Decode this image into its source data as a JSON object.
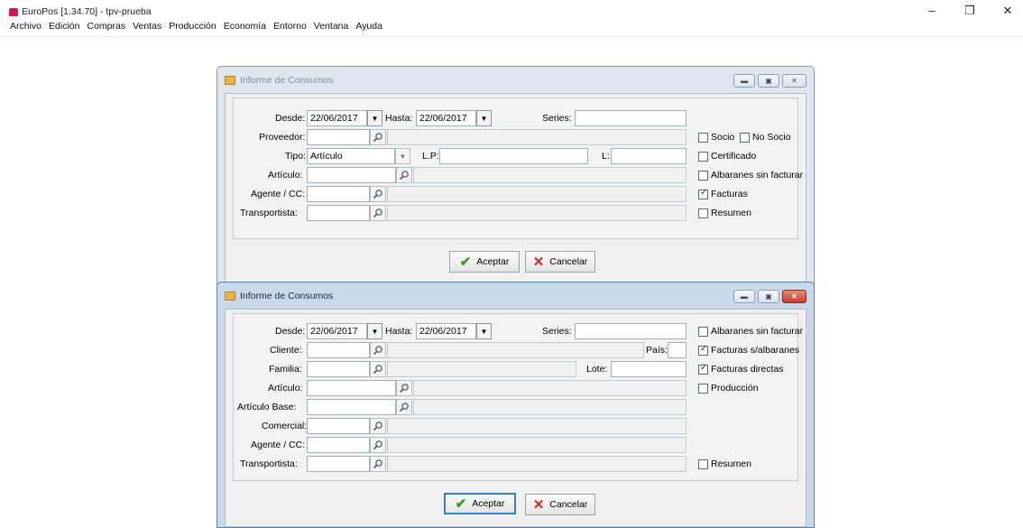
{
  "app": {
    "title": "EuroPos [1.34.70] - tpv-prueba"
  },
  "menu": [
    "Archivo",
    "Edición",
    "Compras",
    "Ventas",
    "Producción",
    "Economía",
    "Entorno",
    "Ventana",
    "Ayuda"
  ],
  "dialog1": {
    "title": "Informe de Consumos",
    "desde_label": "Desde:",
    "desde_value": "22/06/2017",
    "hasta_label": "Hasta:",
    "hasta_value": "22/06/2017",
    "series_label": "Series:",
    "series_value": "",
    "proveedor_label": "Proveedor:",
    "tipo_label": "Tipo:",
    "tipo_value": "Artículo",
    "lp_label": "L.P:",
    "l_label": "L:",
    "articulo_label": "Artículo:",
    "agente_label": "Agente / CC:",
    "transportista_label": "Transportista:",
    "socio_label": "Socio",
    "nosocio_label": "No Socio",
    "certificado_label": "Certificado",
    "albaranes_label": "Albaranes sin facturar",
    "facturas_label": "Facturas",
    "resumen_label": "Resumen",
    "checks": {
      "socio": false,
      "nosocio": false,
      "certificado": false,
      "albaranes": false,
      "facturas": true,
      "resumen": false
    },
    "aceptar_label": "Aceptar",
    "cancelar_label": "Cancelar"
  },
  "dialog2": {
    "title": "Informe de Consumos",
    "desde_label": "Desde:",
    "desde_value": "22/06/2017",
    "hasta_label": "Hasta:",
    "hasta_value": "22/06/2017",
    "series_label": "Series:",
    "cliente_label": "Cliente:",
    "pais_label": "País:",
    "familia_label": "Familia:",
    "lote_label": "Lote:",
    "articulo_label": "Artículo:",
    "articulo_base_label": "Artículo Base:",
    "comercial_label": "Comercial:",
    "agente_label": "Agente / CC:",
    "transportista_label": "Transportista:",
    "albaranes_label": "Albaranes sin facturar",
    "facturas_alb_label": "Facturas s/albaranes",
    "facturas_dir_label": "Facturas directas",
    "produccion_label": "Producción",
    "resumen_label": "Resumen",
    "checks": {
      "albaranes": false,
      "facturas_alb": true,
      "facturas_dir": true,
      "produccion": false,
      "resumen": false
    },
    "aceptar_label": "Aceptar",
    "cancelar_label": "Cancelar"
  },
  "colors": {
    "accept": "#3b9a26",
    "cancel": "#d12a1c",
    "close": "#c4412c",
    "logo": "#d4145a"
  }
}
